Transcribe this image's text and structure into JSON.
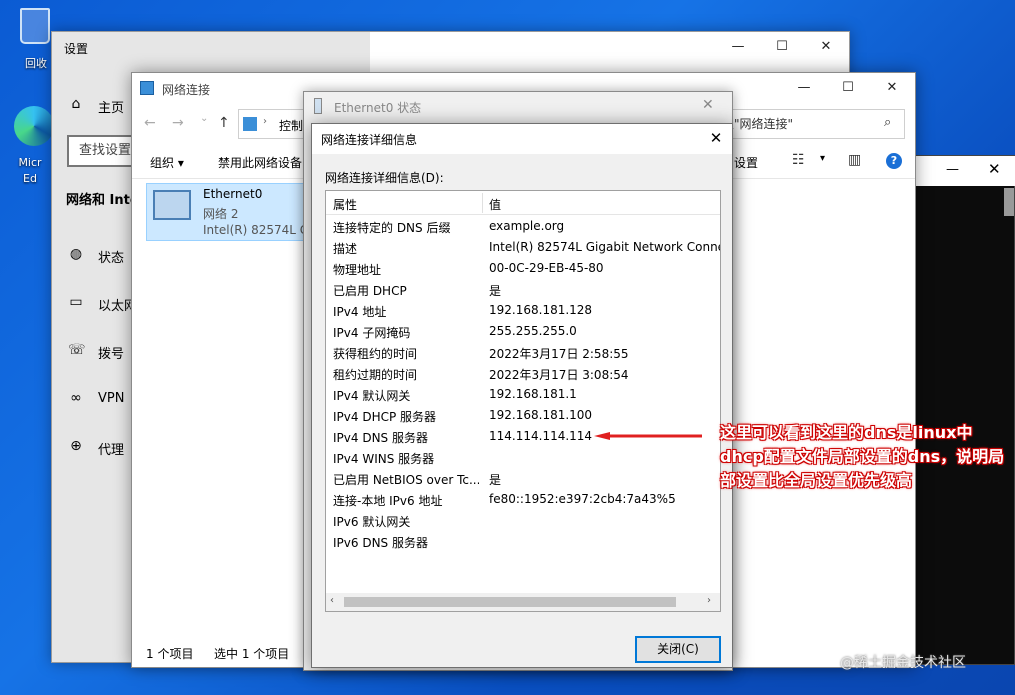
{
  "desktop": {
    "recycle_bin_label": "回收",
    "edge_label": "Micr\nEd"
  },
  "settings": {
    "title": "设置",
    "home": "主页",
    "search_placeholder": "查找设置",
    "section": "网络和 Inte",
    "nav": [
      {
        "label": "状态",
        "icon": "globe-status-icon"
      },
      {
        "label": "以太网",
        "icon": "ethernet-icon"
      },
      {
        "label": "拨号",
        "icon": "dialup-icon"
      },
      {
        "label": "VPN",
        "icon": "vpn-icon"
      },
      {
        "label": "代理",
        "icon": "proxy-globe-icon"
      }
    ]
  },
  "netconn": {
    "title": "网络连接",
    "address_crumb": "控制",
    "search_placeholder": "搜\"网络连接\"",
    "commands": {
      "organize": "组织 ▾",
      "disable": "禁用此网络设备",
      "settings_tail": "设置"
    },
    "item": {
      "name": "Ethernet0",
      "network": "网络 2",
      "adapter": "Intel(R) 82574L Gi"
    },
    "status_count": "1 个项目",
    "status_selected": "选中 1 个项目"
  },
  "props_dialog": {
    "title": "Ethernet0 状态"
  },
  "details_dialog": {
    "title": "网络连接详细信息",
    "list_label": "网络连接详细信息(D):",
    "col_property": "属性",
    "col_value": "值",
    "rows": [
      {
        "k": "连接特定的 DNS 后缀",
        "v": "example.org"
      },
      {
        "k": "描述",
        "v": "Intel(R) 82574L Gigabit Network Connec"
      },
      {
        "k": "物理地址",
        "v": "00-0C-29-EB-45-80"
      },
      {
        "k": "已启用 DHCP",
        "v": "是"
      },
      {
        "k": "IPv4 地址",
        "v": "192.168.181.128"
      },
      {
        "k": "IPv4 子网掩码",
        "v": "255.255.255.0"
      },
      {
        "k": "获得租约的时间",
        "v": "2022年3月17日 2:58:55"
      },
      {
        "k": "租约过期的时间",
        "v": "2022年3月17日 3:08:54"
      },
      {
        "k": "IPv4 默认网关",
        "v": "192.168.181.1"
      },
      {
        "k": "IPv4 DHCP 服务器",
        "v": "192.168.181.100"
      },
      {
        "k": "IPv4 DNS 服务器",
        "v": "114.114.114.114"
      },
      {
        "k": "IPv4 WINS 服务器",
        "v": ""
      },
      {
        "k": "已启用 NetBIOS over Tc...",
        "v": "是"
      },
      {
        "k": "连接-本地 IPv6 地址",
        "v": "fe80::1952:e397:2cb4:7a43%5"
      },
      {
        "k": "IPv6 默认网关",
        "v": ""
      },
      {
        "k": "IPv6 DNS 服务器",
        "v": ""
      }
    ],
    "close_button": "关闭(C)"
  },
  "annotation": {
    "text": "这里可以看到这里的dns是linux中dhcp配置文件局部设置的dns，说明局部设置比全局设置优先级高",
    "color": "#e02020"
  },
  "watermark": "@稀土掘金技术社区"
}
